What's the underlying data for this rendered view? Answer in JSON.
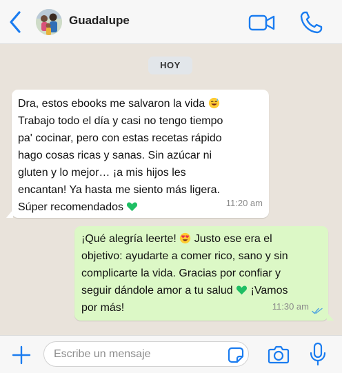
{
  "header": {
    "contact_name": "Guadalupe",
    "back_icon": "chevron-left-icon",
    "avatar_icon": "avatar",
    "video_icon": "video-camera-icon",
    "call_icon": "phone-icon",
    "accent_color": "#1a7cf0"
  },
  "chat": {
    "date_label": "HOY",
    "messages": [
      {
        "direction": "incoming",
        "text_before_emoji": "Dra, estos ebooks me salvaron la vida ",
        "emoji_1": "smiling-face-with-sweat-emoji",
        "text_middle": "\nTrabajo todo el día y casi no tengo tiempo\npa' cocinar, pero con estas recetas rápido\nhago cosas ricas y sanas. Sin azúcar ni\ngluten y lo mejor… ¡a mis hijos les\nencantan! Ya hasta me siento más ligera.\nSúper recomendados ",
        "emoji_2": "green-heart-emoji",
        "time": "11:20 am"
      },
      {
        "direction": "outgoing",
        "text_before_emoji": "¡Qué alegría leerte! ",
        "emoji_1": "heart-eyes-emoji",
        "text_middle": " Justo ese era el\nobjetivo: ayudarte a comer rico, sano y sin\ncomplicarte la vida. Gracias por confiar y\nseguir dándole amor a tu salud ",
        "emoji_2": "green-heart-emoji",
        "text_after": " ¡Vamos\npor más!",
        "time": "11:30 am",
        "status_icon": "double-check-read-icon"
      }
    ]
  },
  "footer": {
    "placeholder": "Escribe un mensaje",
    "plus_icon": "plus-icon",
    "sticker_icon": "sticker-icon",
    "camera_icon": "camera-icon",
    "mic_icon": "microphone-icon"
  },
  "colors": {
    "chat_background": "#e9e3db",
    "incoming_bubble": "#ffffff",
    "outgoing_bubble": "#dcf8c6",
    "read_ticks": "#4fa3e0"
  }
}
